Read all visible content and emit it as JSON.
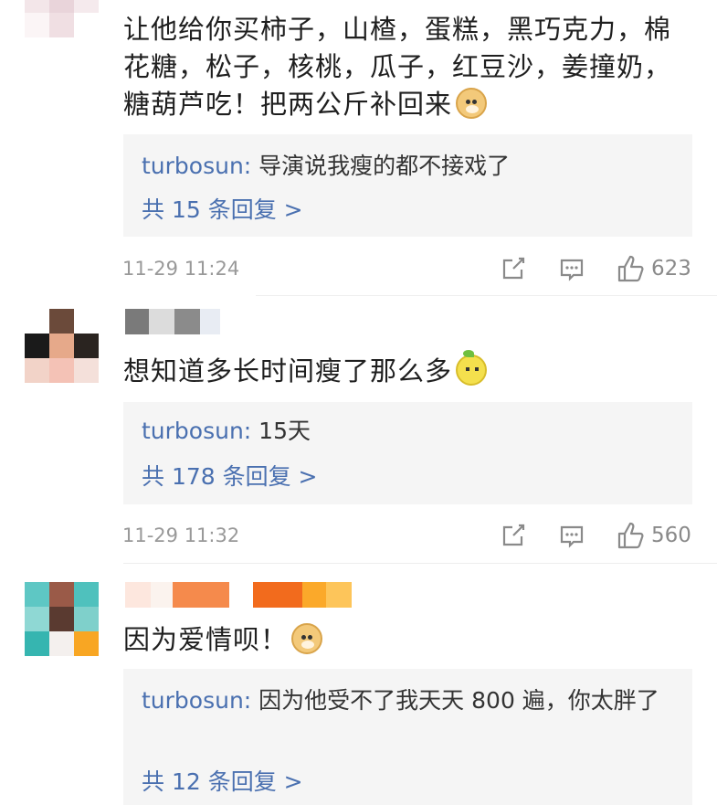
{
  "comments": [
    {
      "text": "让他给你买柿子，山楂，蛋糕，黑巧克力，棉花糖，松子，核桃，瓜子，红豆沙，姜撞奶，糖葫芦吃！把两公斤补回来",
      "emoji": "doge-emoji",
      "reply_user": "turbosun:",
      "reply_text": " 导演说我瘦的都不接戏了",
      "more_replies": "共 15 条回复 >",
      "timestamp": "11-29 11:24",
      "likes": "623"
    },
    {
      "text": "想知道多长时间瘦了那么多",
      "emoji": "lemon-emoji",
      "reply_user": "turbosun:",
      "reply_text": " 15天",
      "more_replies": "共 178 条回复 >",
      "timestamp": "11-29 11:32",
      "likes": "560"
    },
    {
      "text": "因为爱情呗！",
      "emoji": "doge-emoji",
      "reply_user": "turbosun:",
      "reply_text": " 因为他受不了我天天 800 遍，你太胖了",
      "more_replies": "共 12 条回复 >"
    }
  ],
  "colors": {
    "link_blue": "#4a70b0",
    "meta_gray": "#999999",
    "reply_bg": "#f5f5f5"
  },
  "icons": [
    "share-icon",
    "comment-icon",
    "like-icon"
  ]
}
